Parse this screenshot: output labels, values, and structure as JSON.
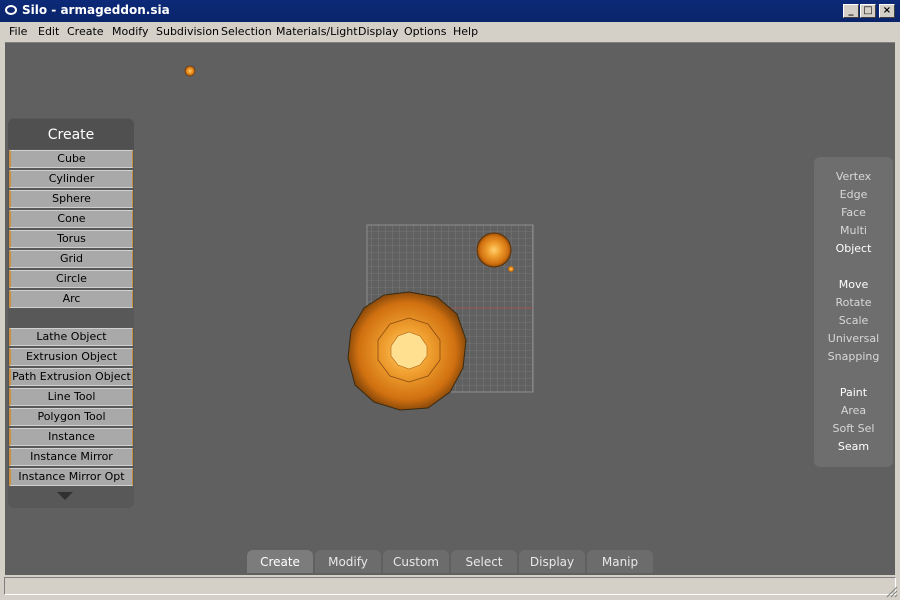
{
  "window": {
    "title": "Silo  - armageddon.sia",
    "minimize": "_",
    "maximize": "□",
    "close": "×"
  },
  "menu": [
    "File",
    "Edit",
    "Create",
    "Modify",
    "Subdivision",
    "Selection",
    "Materials/Light",
    "Display",
    "Options",
    "Help"
  ],
  "create_panel": {
    "title": "Create",
    "primitives": [
      "Cube",
      "Cylinder",
      "Sphere",
      "Cone",
      "Torus",
      "Grid",
      "Circle",
      "Arc"
    ],
    "tools": [
      "Lathe Object",
      "Extrusion Object",
      "Path Extrusion Object",
      "Line Tool",
      "Polygon Tool",
      "Instance",
      "Instance Mirror",
      "Instance Mirror Opt"
    ]
  },
  "mode_panel": {
    "selection_modes": [
      "Vertex",
      "Edge",
      "Face",
      "Multi",
      "Object"
    ],
    "active_mode": "Object",
    "manipulators": [
      "Move",
      "Rotate",
      "Scale",
      "Universal",
      "Snapping"
    ],
    "brushes": [
      "Paint",
      "Area",
      "Soft Sel",
      "Seam"
    ]
  },
  "tabs": [
    "Create",
    "Modify",
    "Custom",
    "Select",
    "Display",
    "Manip"
  ],
  "active_tab": "Create",
  "colors": {
    "viewport": "#606060",
    "accent": "#e8861a",
    "titlebar": "#0a246a"
  }
}
